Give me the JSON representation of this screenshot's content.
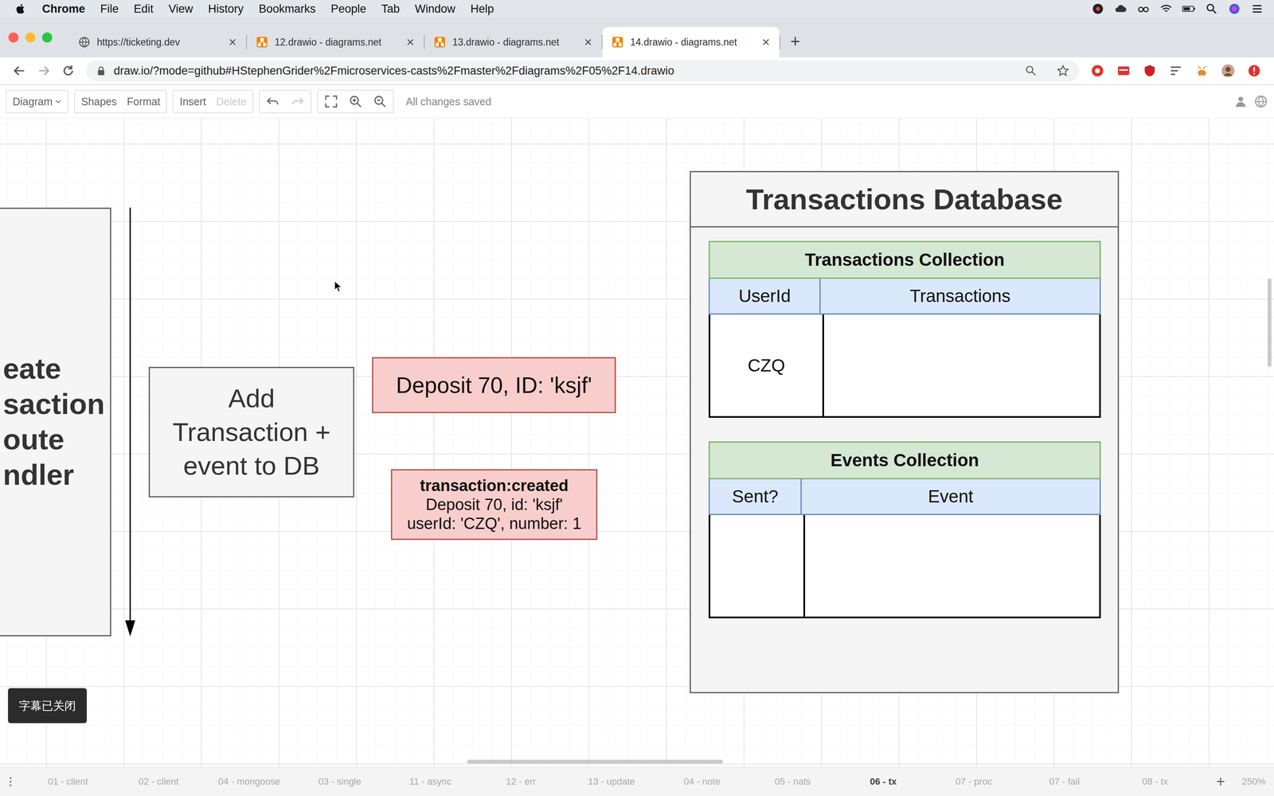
{
  "menubar": {
    "app": "Chrome",
    "items": [
      "File",
      "Edit",
      "View",
      "History",
      "Bookmarks",
      "People",
      "Tab",
      "Window",
      "Help"
    ]
  },
  "tabs": [
    {
      "label": "https://ticketing.dev",
      "selected": false
    },
    {
      "label": "12.drawio - diagrams.net",
      "selected": false
    },
    {
      "label": "13.drawio - diagrams.net",
      "selected": false
    },
    {
      "label": "14.drawio - diagrams.net",
      "selected": true
    }
  ],
  "new_tab": "+",
  "address": "draw.io/?mode=github#HStephenGrider%2Fmicroservices-casts%2Fmaster%2Fdiagrams%2F05%2F14.drawio",
  "toolbar": {
    "groups": [
      [
        {
          "label": "Diagram",
          "disabled": false
        }
      ],
      [
        {
          "label": "Shapes",
          "disabled": false
        },
        {
          "label": "Format",
          "disabled": false
        }
      ],
      [
        {
          "label": "Insert",
          "disabled": false
        },
        {
          "label": "Delete",
          "disabled": true
        }
      ]
    ],
    "icon_groups": [
      [
        {
          "kind": "undo",
          "disabled": false
        },
        {
          "kind": "redo",
          "disabled": true
        }
      ],
      [
        {
          "kind": "fullscreen",
          "disabled": false
        },
        {
          "kind": "zoom-in",
          "disabled": false
        },
        {
          "kind": "zoom-out",
          "disabled": false
        }
      ]
    ],
    "status": "All changes saved"
  },
  "diagram": {
    "route_handler": {
      "lines": [
        "eate",
        "saction",
        "oute",
        "ndler"
      ]
    },
    "step": {
      "lines": [
        "Add",
        "Transaction +",
        "event to DB"
      ]
    },
    "record": "Deposit 70, ID: 'ksjf'",
    "event": {
      "title": "transaction:created",
      "lines": [
        "Deposit 70, id: 'ksjf'",
        "userId: 'CZQ', number: 1"
      ]
    },
    "database": {
      "title": "Transactions Database",
      "collections": [
        {
          "title": "Transactions Collection",
          "columns": [
            "UserId",
            "Transactions"
          ],
          "rows": [
            [
              "CZQ",
              ""
            ]
          ]
        },
        {
          "title": "Events Collection",
          "columns": [
            "Sent?",
            "Event"
          ],
          "rows": [
            [
              "",
              ""
            ]
          ]
        }
      ]
    }
  },
  "subtitle_toast": "字幕已关闭",
  "page_tabs": [
    {
      "label": "01 - client",
      "selected": false
    },
    {
      "label": "02 - client",
      "selected": false
    },
    {
      "label": "04 - mongoose",
      "selected": false
    },
    {
      "label": "03 - single",
      "selected": false
    },
    {
      "label": "11 - async",
      "selected": false
    },
    {
      "label": "12 - err",
      "selected": false
    },
    {
      "label": "13 - update",
      "selected": false
    },
    {
      "label": "04 - note",
      "selected": false
    },
    {
      "label": "05 - nats",
      "selected": false
    },
    {
      "label": "06 - tx",
      "selected": true
    },
    {
      "label": "07 - proc",
      "selected": false
    },
    {
      "label": "07 - fail",
      "selected": false
    },
    {
      "label": "08 - tx",
      "selected": false
    }
  ],
  "add_page": "+",
  "zoom": "250%"
}
